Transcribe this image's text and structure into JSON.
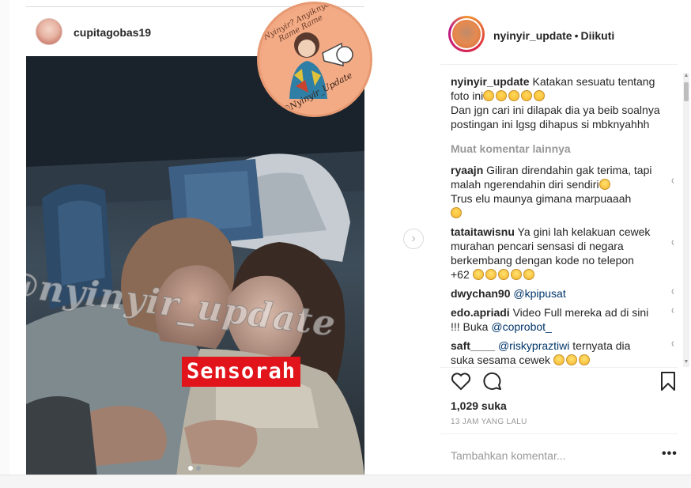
{
  "post": {
    "author": "cupitagobas19",
    "more_label": "•••"
  },
  "media": {
    "watermark": "@nyinyir_update",
    "censor_label": "Sensorah",
    "badge_top_text": "Nyinyir? Anyiknya Rame Rame",
    "badge_bottom_text": "@Nyinyir_Update",
    "carousel_dots": 2,
    "carousel_active": 0,
    "next_icon": "chevron-right-icon"
  },
  "panel": {
    "owner": "nyinyir_update",
    "separator": "•",
    "follow_state": "Diikuti",
    "caption": {
      "username": "nyinyir_update",
      "text1": "Katakan sesuatu tentang foto ini",
      "text2": "Dan jgn cari ini dilapak dia ya beib soalnya postingan ini lgsg dihapus si mbknyahhh"
    },
    "load_more": "Muat komentar lainnya",
    "comments": [
      {
        "user": "ryaajn",
        "text": "Giliran direndahin gak terima, tapi malah ngerendahin diri sendiri",
        "text2": "Trus elu maunya gimana marpuaaah"
      },
      {
        "user": "tataitawisnu",
        "text": "Ya gini lah kelakuan cewek murahan pencari sensasi di negara berkembang dengan kode no telepon +62"
      },
      {
        "user": "dwychan90",
        "mention": "@kpipusat"
      },
      {
        "user": "edo.apriadi",
        "text": "Video Full mereka ad di sini !!! Buka",
        "mention": "@coprobot_"
      },
      {
        "user": "saft____",
        "mention": "@riskypraztiwi",
        "text": "ternyata dia suka sesama cewek"
      }
    ],
    "likes": "1,029 suka",
    "time": "13 JAM YANG LALU",
    "add_comment_placeholder": "Tambahkan komentar...",
    "add_more_label": "•••"
  },
  "colors": {
    "censor": "#e2141b",
    "mention": "#003569",
    "muted": "#999999",
    "text": "#262626"
  }
}
